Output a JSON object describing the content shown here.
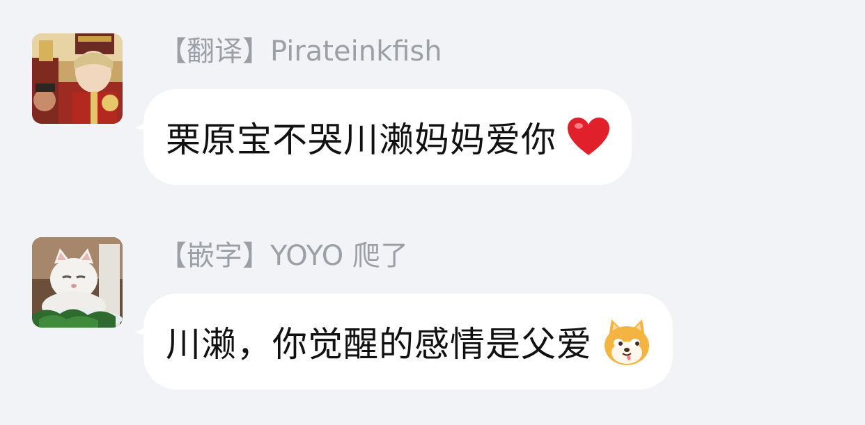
{
  "messages": [
    {
      "sender": "【翻译】Pirateinkfish",
      "text": "栗原宝不哭川濑妈妈爱你",
      "emoji": "heart-emoji",
      "avatar": "anime-soldier-avatar"
    },
    {
      "sender": "【嵌字】YOYO 爬了",
      "text": "川濑，你觉醒的感情是父爱",
      "emoji": "shiba-dog-emoji",
      "avatar": "white-cat-avatar"
    }
  ],
  "colors": {
    "background": "#f2f3f7",
    "bubble": "#ffffff",
    "sender_name": "#9d9fa6",
    "text": "#111111",
    "heart": "#e0202a",
    "dog": "#f3b441"
  }
}
